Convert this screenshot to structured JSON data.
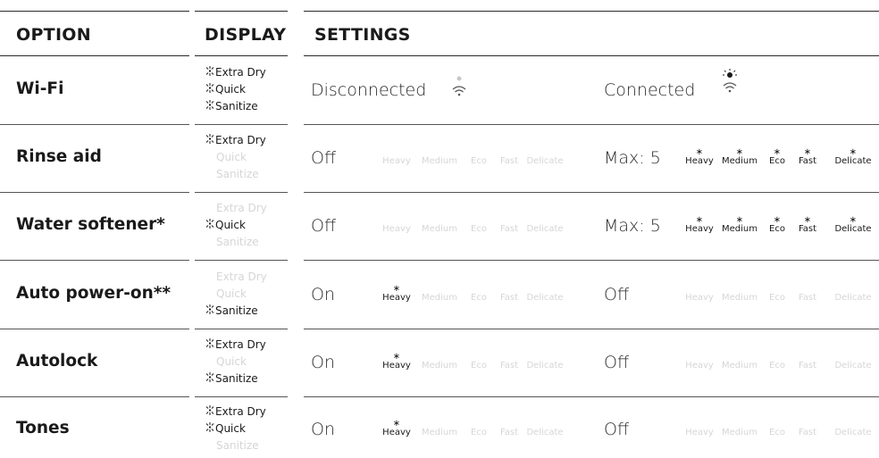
{
  "headers": {
    "option": "OPTION",
    "display": "DISPLAY",
    "settings": "SETTINGS"
  },
  "display_labels": [
    "Extra Dry",
    "Quick",
    "Sanitize"
  ],
  "cycle_labels": [
    "Heavy",
    "Medium",
    "Eco",
    "Fast",
    "Delicate"
  ],
  "rows": [
    {
      "option": "Wi-Fi",
      "display_lit": [
        true,
        true,
        true
      ],
      "setting_a": "Disconnected",
      "setting_b": "Connected",
      "a_lit": [],
      "b_lit": []
    },
    {
      "option": "Rinse aid",
      "display_lit": [
        true,
        false,
        false
      ],
      "setting_a": "Off",
      "setting_b": "Max: 5",
      "a_lit": [
        false,
        false,
        false,
        false,
        false
      ],
      "b_lit": [
        true,
        true,
        true,
        true,
        true
      ]
    },
    {
      "option": "Water softener*",
      "display_lit": [
        false,
        true,
        false
      ],
      "setting_a": "Off",
      "setting_b": "Max: 5",
      "a_lit": [
        false,
        false,
        false,
        false,
        false
      ],
      "b_lit": [
        true,
        true,
        true,
        true,
        true
      ]
    },
    {
      "option": "Auto power-on**",
      "display_lit": [
        false,
        false,
        true
      ],
      "setting_a": "On",
      "setting_b": "Off",
      "a_lit": [
        true,
        false,
        false,
        false,
        false
      ],
      "b_lit": [
        false,
        false,
        false,
        false,
        false
      ]
    },
    {
      "option": "Autolock",
      "display_lit": [
        true,
        false,
        true
      ],
      "setting_a": "On",
      "setting_b": "Off",
      "a_lit": [
        true,
        false,
        false,
        false,
        false
      ],
      "b_lit": [
        false,
        false,
        false,
        false,
        false
      ]
    },
    {
      "option": "Tones",
      "display_lit": [
        true,
        true,
        false
      ],
      "setting_a": "On",
      "setting_b": "Off",
      "a_lit": [
        true,
        false,
        false,
        false,
        false
      ],
      "b_lit": [
        false,
        false,
        false,
        false,
        false
      ]
    }
  ]
}
